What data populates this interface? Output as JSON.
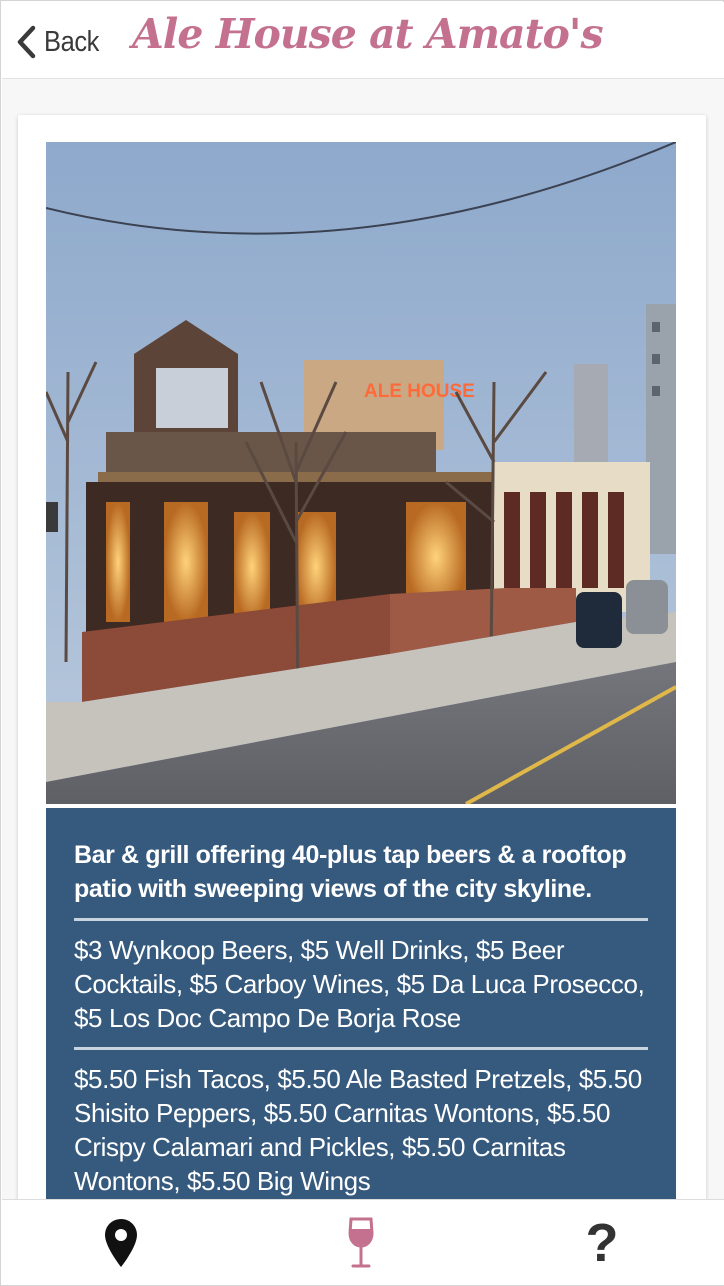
{
  "header": {
    "back_label": "Back",
    "title": "Ale House at Amato's"
  },
  "photo": {
    "sign_text": "ALE HOUSE"
  },
  "details": {
    "summary": "Bar & grill offering 40-plus tap beers & a rooftop patio with sweeping views of the city skyline.",
    "drink_specials": "$3 Wynkoop Beers, $5 Well Drinks, $5 Beer Cocktails, $5 Carboy Wines, $5 Da Luca Prosecco, $5 Los Doc Campo De Borja Rose",
    "food_specials": "$5.50 Fish Tacos, $5.50 Ale Basted Pretzels, $5.50 Shisito Peppers, $5.50 Carnitas Wontons, $5.50 Crispy Calamari and Pickles, $5.50 Carnitas Wontons, $5.50 Big Wings"
  },
  "tabbar": {
    "tabs": [
      {
        "icon": "map-pin-icon",
        "active": false
      },
      {
        "icon": "wine-glass-icon",
        "active": true
      },
      {
        "icon": "question-mark-icon",
        "active": false
      }
    ],
    "help_glyph": "?"
  },
  "colors": {
    "title": "#c4718f",
    "info_panel": "#365a7e",
    "active_tab": "#c4718f",
    "inactive_tab": "#111111"
  }
}
